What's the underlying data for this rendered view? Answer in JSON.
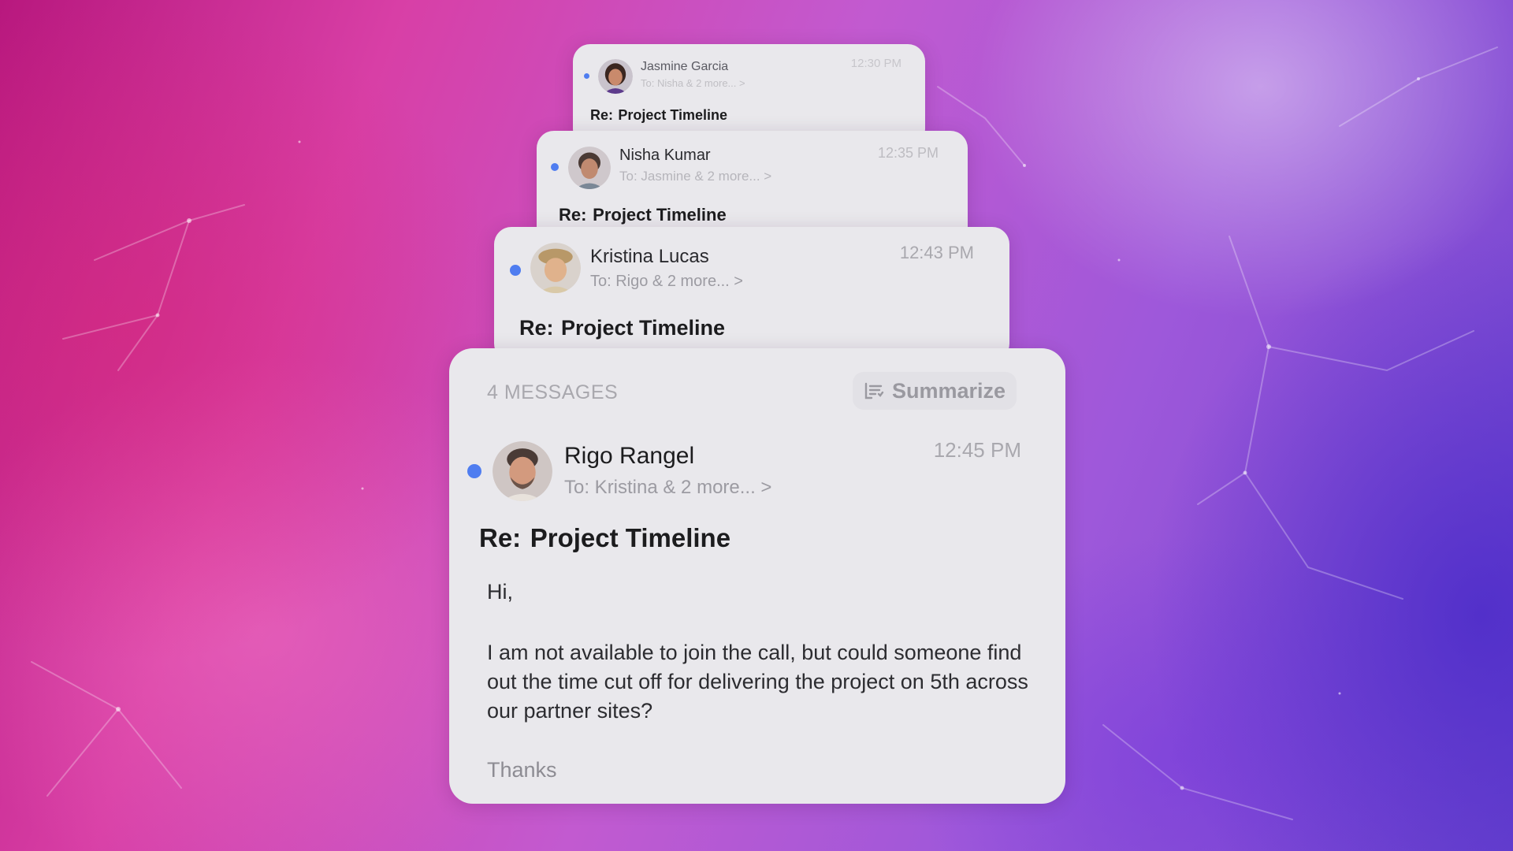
{
  "colors": {
    "unread_dot": "#4f7df0",
    "card_bg": "#e9e8ec",
    "background_start": "#b8187e",
    "background_end": "#6c44cf"
  },
  "thread": {
    "messages": [
      {
        "sender": "Jasmine Garcia",
        "recipients": "To: Nisha & 2 more...  >",
        "time": "12:30 PM",
        "subject_prefix": "Re:",
        "subject": "Project Timeline",
        "avatar_icon": "avatar-jasmine-icon",
        "unread": true
      },
      {
        "sender": "Nisha Kumar",
        "recipients": "To: Jasmine & 2 more...  >",
        "time": "12:35 PM",
        "subject_prefix": "Re:",
        "subject": "Project Timeline",
        "avatar_icon": "avatar-nisha-icon",
        "unread": true
      },
      {
        "sender": "Kristina Lucas",
        "recipients": "To: Rigo & 2 more...  >",
        "time": "12:43 PM",
        "subject_prefix": "Re:",
        "subject": "Project Timeline",
        "avatar_icon": "avatar-kristina-icon",
        "unread": true
      },
      {
        "sender": "Rigo Rangel",
        "recipients": "To: Kristina & 2 more...  >",
        "time": "12:45 PM",
        "subject_prefix": "Re:",
        "subject": "Project Timeline",
        "avatar_icon": "avatar-rigo-icon",
        "unread": true,
        "body": {
          "greeting": "Hi,",
          "paragraph": "I am not available to join the call, but could someone find out the time cut off for delivering the project on 5th across our partner sites?",
          "signoff": "Thanks"
        }
      }
    ],
    "message_count_label": "4 MESSAGES",
    "summarize_label": "Summarize",
    "summarize_icon": "summarize-icon"
  }
}
